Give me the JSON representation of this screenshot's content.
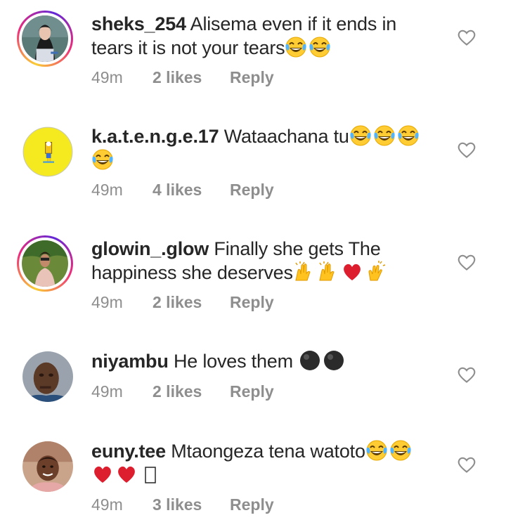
{
  "comments": [
    {
      "username": "sheks_254",
      "text": "Alisema even if it ends in tears it is not your tears",
      "emojis": [
        "laughing-tears",
        "laughing-tears"
      ],
      "time": "49m",
      "likes": "2 likes",
      "reply": "Reply",
      "has_story_ring": true
    },
    {
      "username": "k.a.t.e.n.g.e.17",
      "text": "Wataachana tu",
      "emojis": [
        "laughing-tears",
        "laughing-tears",
        "laughing-tears",
        "laughing-tears"
      ],
      "time": "49m",
      "likes": "4 likes",
      "reply": "Reply",
      "has_story_ring": false
    },
    {
      "username": "glowin_.glow",
      "text": "Finally she gets The happiness she deserves",
      "emojis": [
        "raising-hands",
        "raising-hands",
        "red-heart",
        "clapping-hands"
      ],
      "time": "49m",
      "likes": "2 likes",
      "reply": "Reply",
      "has_story_ring": true
    },
    {
      "username": "niyambu",
      "text": "He loves them",
      "emojis": [
        "black-circle",
        "black-circle"
      ],
      "time": "49m",
      "likes": "2 likes",
      "reply": "Reply",
      "has_story_ring": false
    },
    {
      "username": "euny.tee",
      "text": "Mtaongeza tena watoto",
      "emojis": [
        "laughing-tears",
        "laughing-tears",
        "red-heart",
        "red-heart",
        "missing-glyph"
      ],
      "time": "49m",
      "likes": "3 likes",
      "reply": "Reply",
      "has_story_ring": false
    }
  ],
  "colors": {
    "text": "#262626",
    "meta": "#8e8e8e",
    "heart_outline": "#8e8e8e"
  }
}
